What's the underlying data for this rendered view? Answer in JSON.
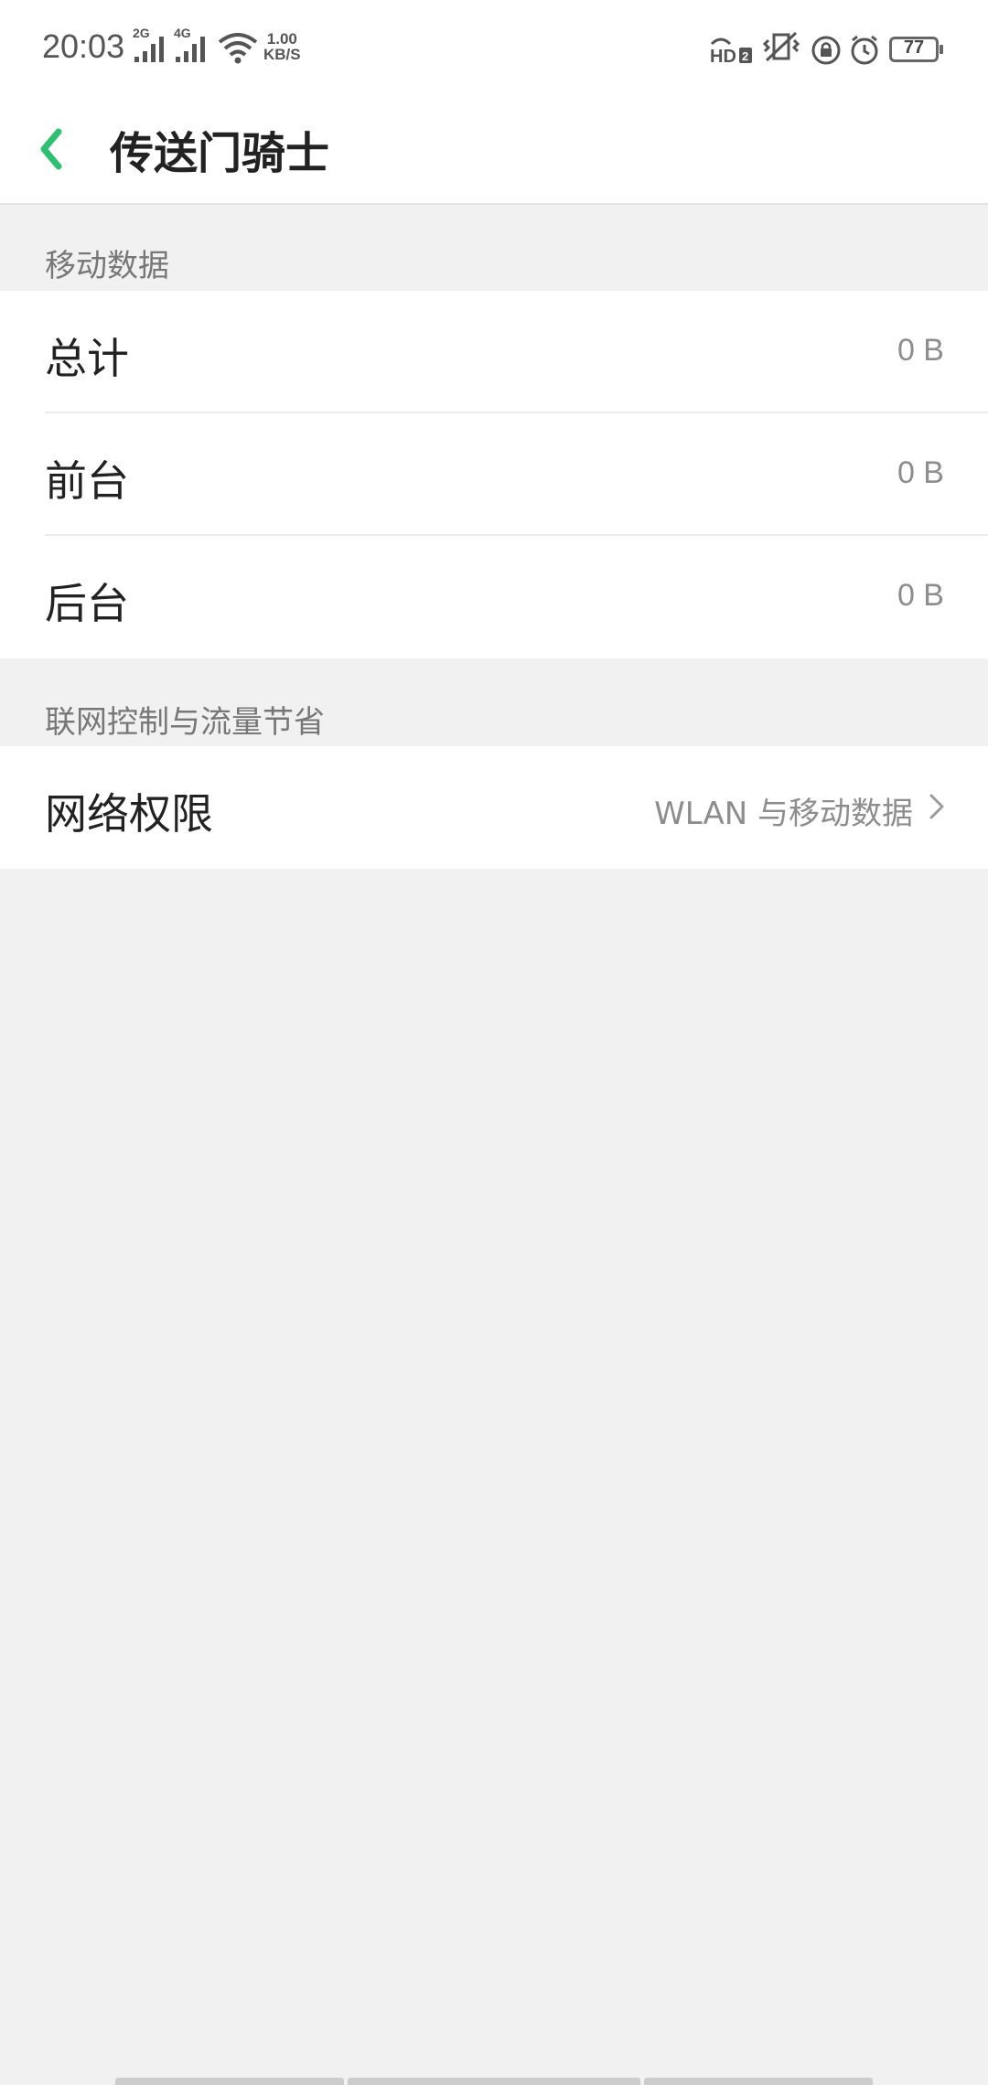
{
  "status_bar": {
    "time": "20:03",
    "signal1_label": "2G",
    "signal2_label": "4G",
    "net_speed_value": "1.00",
    "net_speed_unit": "KB/S",
    "battery": "77",
    "icons": [
      "signal-icon",
      "signal-icon",
      "wifi-icon",
      "hd-icon",
      "vibrate-icon",
      "rotation-lock-icon",
      "alarm-icon",
      "battery-icon"
    ]
  },
  "header": {
    "title": "传送门骑士"
  },
  "mobile_data": {
    "section_title": "移动数据",
    "rows": [
      {
        "label": "总计",
        "value": "0 B"
      },
      {
        "label": "前台",
        "value": "0 B"
      },
      {
        "label": "后台",
        "value": "0 B"
      }
    ]
  },
  "network_control": {
    "section_title": "联网控制与流量节省",
    "permission": {
      "label": "网络权限",
      "value": "WLAN 与移动数据"
    }
  },
  "colors": {
    "accent": "#2fbf71",
    "background": "#f1f1f1",
    "card": "#ffffff"
  }
}
